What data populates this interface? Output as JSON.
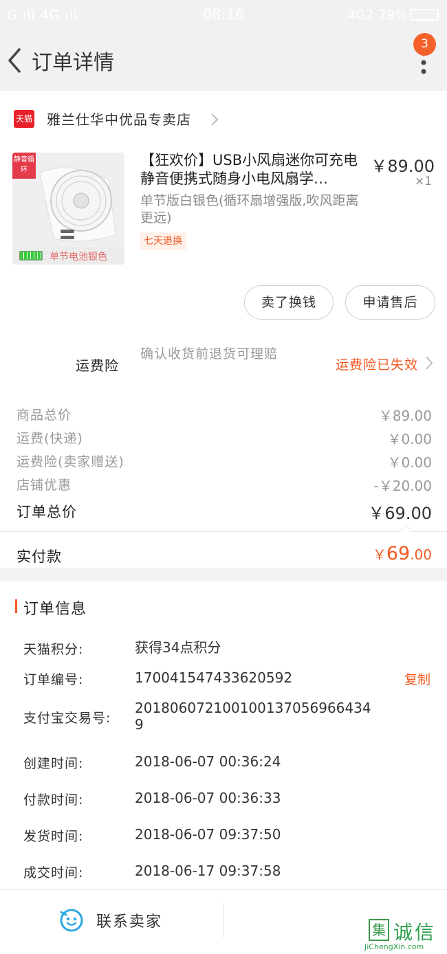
{
  "status_bar": {
    "signal": "G ıll 4G ıll",
    "time": "08:16",
    "right": "4G2 79%"
  },
  "nav": {
    "title": "订单详情",
    "badge": "3"
  },
  "store": {
    "tag": "天猫",
    "name": "雅兰仕华中优品专卖店"
  },
  "product": {
    "thumb_tag": "静音循环",
    "thumb_caption": "单节电池银色",
    "title": "【狂欢价】USB小风扇迷你可充电静音便携式随身小电风扇学…",
    "price": "￥89.00",
    "qty": "×1",
    "spec": "单节版白银色(循环扇增强版,吹风距离更远)",
    "return_tag": "七天退换"
  },
  "buttons": {
    "resell": "卖了换钱",
    "aftersale": "申请售后"
  },
  "insurance": {
    "label": "运费险",
    "desc": "确认收货前退货可理赔",
    "status": "运费险已失效"
  },
  "fees": [
    {
      "label": "商品总价",
      "value": "￥89.00"
    },
    {
      "label": "运费(快递)",
      "value": "￥0.00"
    },
    {
      "label": "运费险(卖家赠送)",
      "value": "￥0.00"
    },
    {
      "label": "店铺优惠",
      "value": "-￥20.00"
    }
  ],
  "total": {
    "label": "订单总价",
    "value": "￥69.00"
  },
  "paid": {
    "label": "实付款",
    "symbol": "￥",
    "integer": "69",
    "decimal": ".00"
  },
  "order_info": {
    "title": "订单信息",
    "rows": [
      {
        "label": "天猫积分:",
        "value": "获得34点积分"
      },
      {
        "label": "订单编号:",
        "value": "170041547433620592"
      },
      {
        "label": "支付宝交易号:",
        "value": "2018060721001001370569664349"
      },
      {
        "label": "创建时间:",
        "value": "2018-06-07 00:36:24"
      },
      {
        "label": "付款时间:",
        "value": "2018-06-07 00:36:33"
      },
      {
        "label": "发货时间:",
        "value": "2018-06-07 09:37:50"
      },
      {
        "label": "成交时间:",
        "value": "2018-06-17 09:37:58"
      }
    ],
    "copy_label": "复制"
  },
  "bottom": {
    "contact": "联系卖家"
  },
  "watermark": {
    "box": "集",
    "text": "诚信",
    "url": "JiChengXin.com"
  }
}
